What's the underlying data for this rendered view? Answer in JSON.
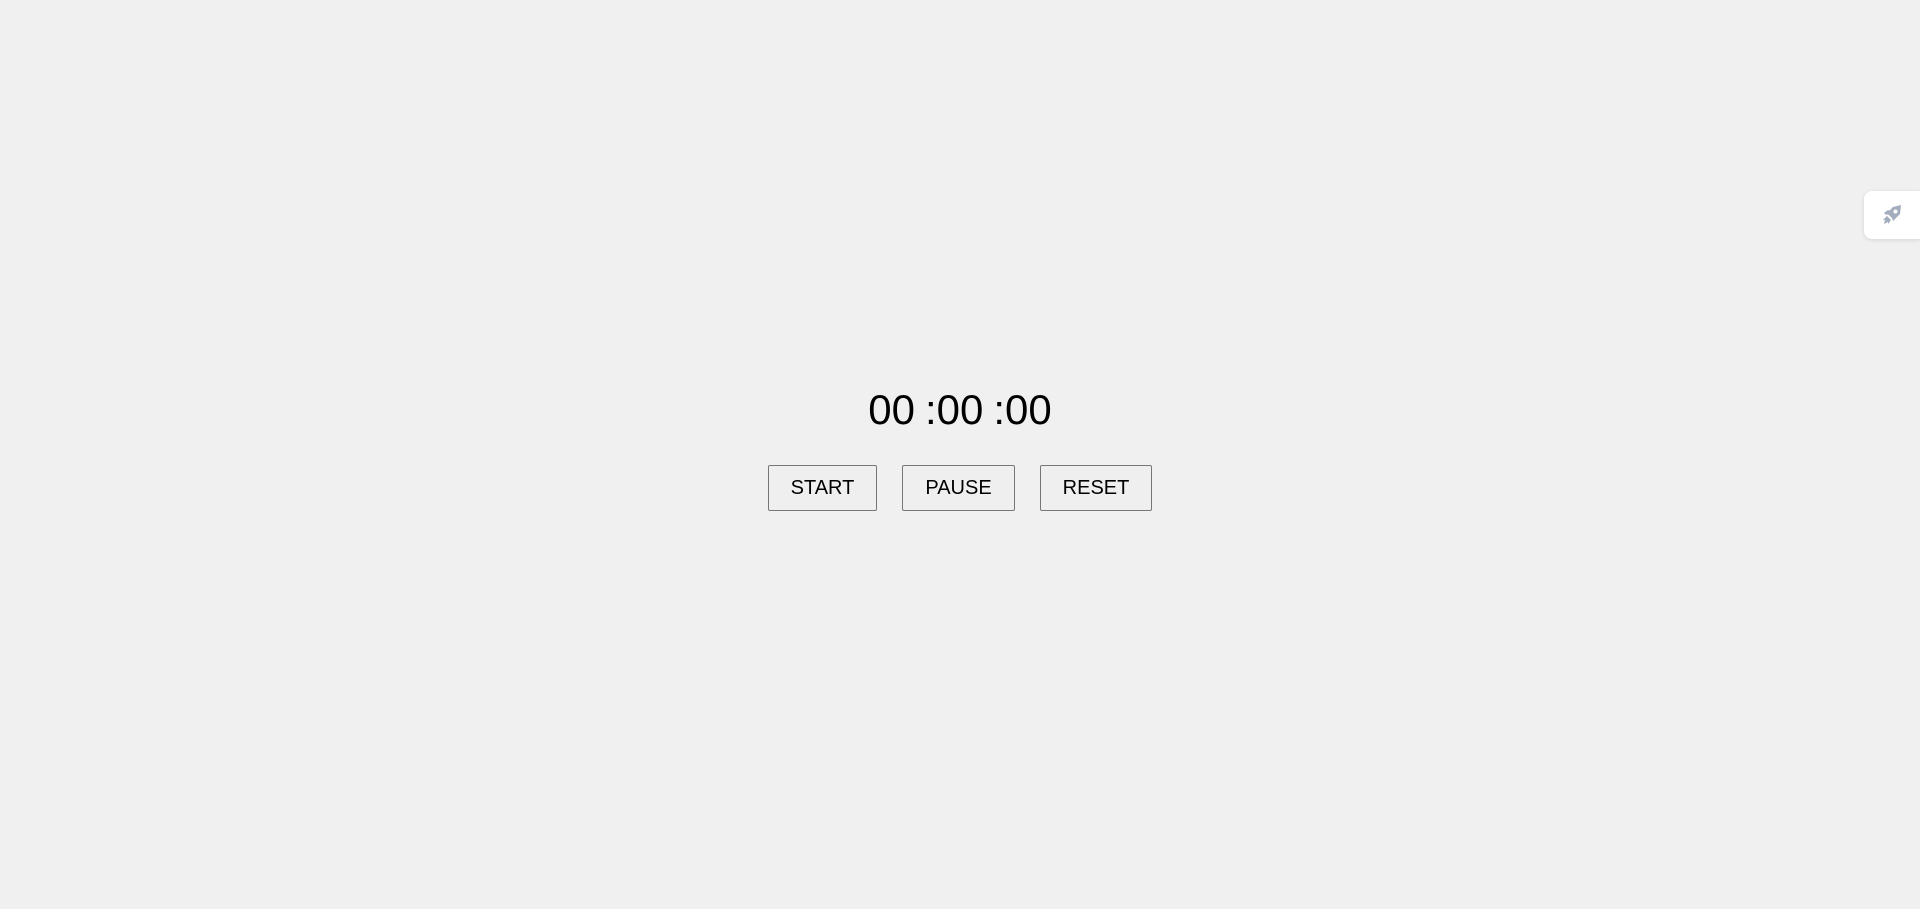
{
  "stopwatch": {
    "hours": "00",
    "minutes": ":00",
    "seconds": ":00"
  },
  "controls": {
    "start_label": "START",
    "pause_label": "PAUSE",
    "reset_label": "RESET"
  },
  "side_widget": {
    "icon": "rocket-icon",
    "icon_color": "#a3adbd"
  }
}
